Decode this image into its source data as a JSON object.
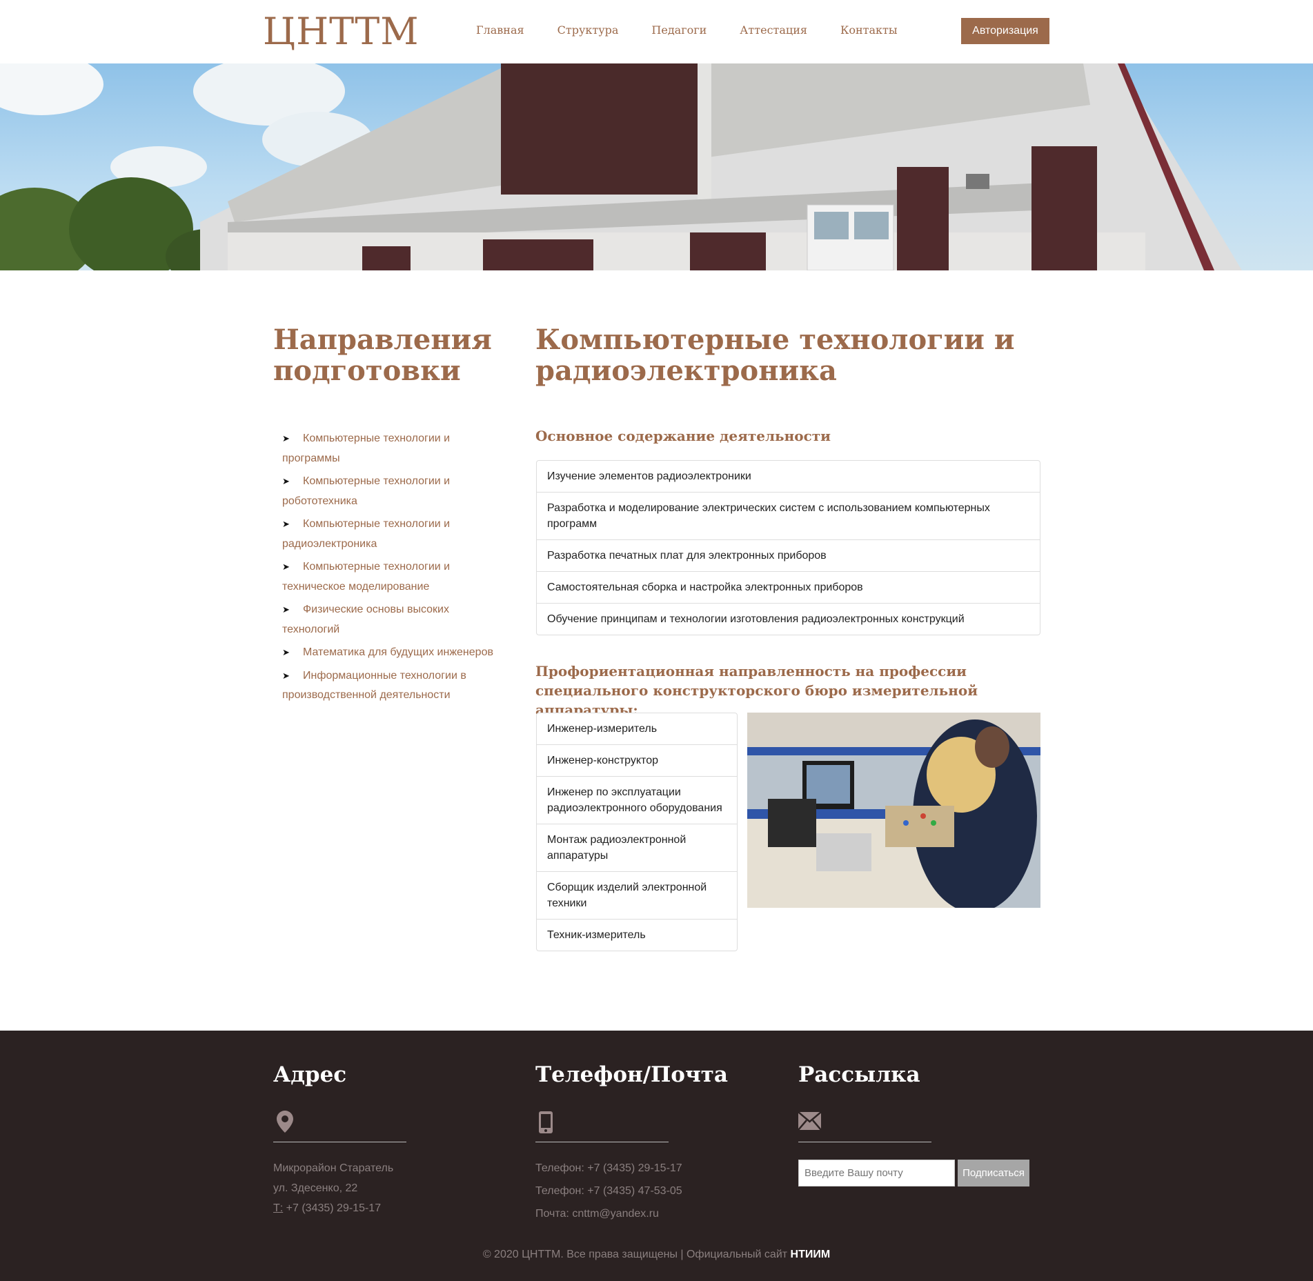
{
  "header": {
    "logo": "ЦНТТМ",
    "nav": [
      "Главная",
      "Структура",
      "Педагоги",
      "Аттестация",
      "Контакты"
    ],
    "auth_label": "Авторизация"
  },
  "sidebar": {
    "title": "Направления подготовки",
    "items": [
      "Компьютерные технологии и программы",
      "Компьютерные технологии и робототехника",
      "Компьютерные технологии и радиоэлектроника",
      "Компьютерные технологии и техническое моделирование",
      "Физические основы высоких технологий",
      "Математика для будущих инженеров",
      "Информационные технологии в производственной деятельности"
    ]
  },
  "main": {
    "title": "Компьютерные технологии и радиоэлектроника",
    "section1_title": "Основное содержание деятельности",
    "activities": [
      "Изучение элементов радиоэлектроники",
      "Разработка и моделирование электрических систем с использованием компьютерных программ",
      "Разработка печатных плат для электронных приборов",
      "Самостоятельная сборка и настройка электронных приборов",
      "Обучение принципам и технологии изготовления радиоэлектронных конструкций"
    ],
    "section2_title": "Профориентационная направленность на профессии специального конструкторского бюро измерительной аппаратуры:",
    "professions": [
      "Инженер-измеритель",
      "Инженер-конструктор",
      "Инженер по эксплуатации радиоэлектронного оборудования",
      "Монтаж радиоэлектронной аппаратуры",
      "Сборщик изделий электронной техники",
      "Техник-измеритель"
    ]
  },
  "footer": {
    "address_title": "Адрес",
    "address_line1": "Микрорайон Старатель",
    "address_line2": "ул. Здесенко, 22",
    "address_phone_prefix": "Т:",
    "address_phone": " +7 (3435) 29-15-17",
    "contacts_title": "Телефон/Почта",
    "phone1": "Телефон: +7 (3435) 29-15-17",
    "phone2": "Телефон: +7 (3435) 47-53-05",
    "email": "Почта: cnttm@yandex.ru",
    "newsletter_title": "Рассылка",
    "email_placeholder": "Введите Вашу почту",
    "subscribe_label": "Подписаться",
    "copyright": "© 2020 ЦНТТМ. Все права защищены | Официальный сайт ",
    "copyright_link": "НТИИМ"
  },
  "colors": {
    "accent": "#9c6a4b",
    "footer_bg": "#2b2222",
    "footer_text": "#8a7f7f"
  }
}
